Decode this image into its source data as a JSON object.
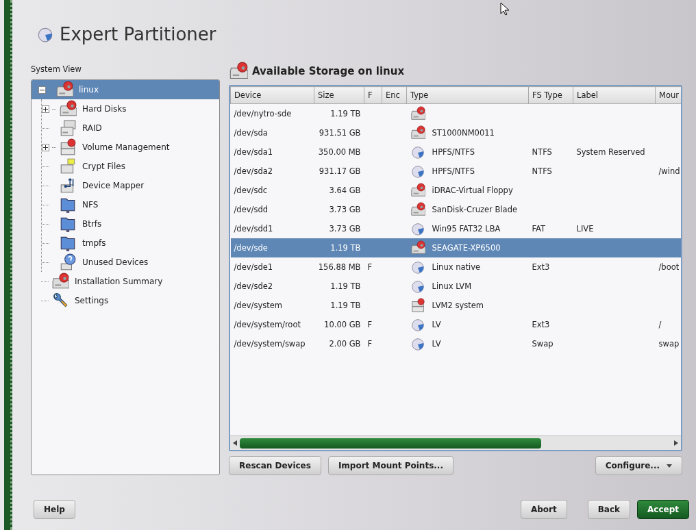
{
  "window": {
    "title": "Expert Partitioner"
  },
  "system_view": {
    "label": "System View",
    "items": [
      {
        "label": "linux",
        "kind": "disk",
        "selected": true,
        "expanded": true,
        "children": [
          {
            "label": "Hard Disks",
            "kind": "disk",
            "selected": false,
            "expanded": false
          },
          {
            "label": "RAID",
            "kind": "raid",
            "selected": false
          },
          {
            "label": "Volume Management",
            "kind": "volume",
            "selected": false,
            "expanded": false
          },
          {
            "label": "Crypt Files",
            "kind": "crypt",
            "selected": false
          },
          {
            "label": "Device Mapper",
            "kind": "mapper",
            "selected": false
          },
          {
            "label": "NFS",
            "kind": "folder",
            "selected": false
          },
          {
            "label": "Btrfs",
            "kind": "folder",
            "selected": false
          },
          {
            "label": "tmpfs",
            "kind": "folder",
            "selected": false
          },
          {
            "label": "Unused Devices",
            "kind": "unused",
            "selected": false
          }
        ]
      },
      {
        "label": "Installation Summary",
        "kind": "disk",
        "selected": false
      },
      {
        "label": "Settings",
        "kind": "settings",
        "selected": false
      }
    ]
  },
  "storage": {
    "title": "Available Storage on linux",
    "columns": [
      "Device",
      "Size",
      "F",
      "Enc",
      "Type",
      "FS Type",
      "Label",
      "Mour"
    ],
    "rows": [
      {
        "device": "/dev/nytro-sde",
        "size": "1.19 TB",
        "kind": "disk",
        "selected": false
      },
      {
        "device": "/dev/sda",
        "size": "931.51 GB",
        "kind": "disk",
        "type": "ST1000NM0011",
        "selected": false
      },
      {
        "device": "/dev/sda1",
        "size": "350.00 MB",
        "kind": "partition",
        "type": "HPFS/NTFS",
        "fs_type": "NTFS",
        "label": "System Reserved",
        "selected": false
      },
      {
        "device": "/dev/sda2",
        "size": "931.17 GB",
        "kind": "partition",
        "type": "HPFS/NTFS",
        "fs_type": "NTFS",
        "mount": "/wind",
        "selected": false
      },
      {
        "device": "/dev/sdc",
        "size": "3.64 GB",
        "kind": "disk",
        "type": "iDRAC-Virtual Floppy",
        "selected": false
      },
      {
        "device": "/dev/sdd",
        "size": "3.73 GB",
        "kind": "disk",
        "type": "SanDisk-Cruzer Blade",
        "selected": false
      },
      {
        "device": "/dev/sdd1",
        "size": "3.73 GB",
        "kind": "partition",
        "type": "Win95 FAT32 LBA",
        "fs_type": "FAT",
        "label": "LIVE",
        "selected": false
      },
      {
        "device": "/dev/sde",
        "size": "1.19 TB",
        "kind": "disk",
        "type": "SEAGATE-XP6500",
        "selected": true
      },
      {
        "device": "/dev/sde1",
        "size": "156.88 MB",
        "f": "F",
        "kind": "partition",
        "type": "Linux native",
        "fs_type": "Ext3",
        "mount": "/boot",
        "selected": false
      },
      {
        "device": "/dev/sde2",
        "size": "1.19 TB",
        "kind": "partition",
        "type": "Linux LVM",
        "selected": false
      },
      {
        "device": "/dev/system",
        "size": "1.19 TB",
        "kind": "volume",
        "type": "LVM2 system",
        "selected": false
      },
      {
        "device": "/dev/system/root",
        "size": "10.00 GB",
        "f": "F",
        "kind": "partition",
        "type": "LV",
        "fs_type": "Ext3",
        "mount": "/",
        "selected": false
      },
      {
        "device": "/dev/system/swap",
        "size": "2.00 GB",
        "f": "F",
        "kind": "partition",
        "type": "LV",
        "fs_type": "Swap",
        "mount": "swap",
        "selected": false
      }
    ],
    "buttons": [
      {
        "label": "Rescan Devices",
        "kind": "plain"
      },
      {
        "label": "Import Mount Points...",
        "kind": "plain"
      },
      {
        "label": "Configure...",
        "kind": "menu"
      }
    ]
  },
  "buttons": {
    "help": "Help",
    "navigation": [
      {
        "label": "Abort",
        "kind": "plain"
      },
      {
        "label": "Back",
        "kind": "plain"
      },
      {
        "label": "Accept",
        "kind": "default"
      }
    ]
  }
}
